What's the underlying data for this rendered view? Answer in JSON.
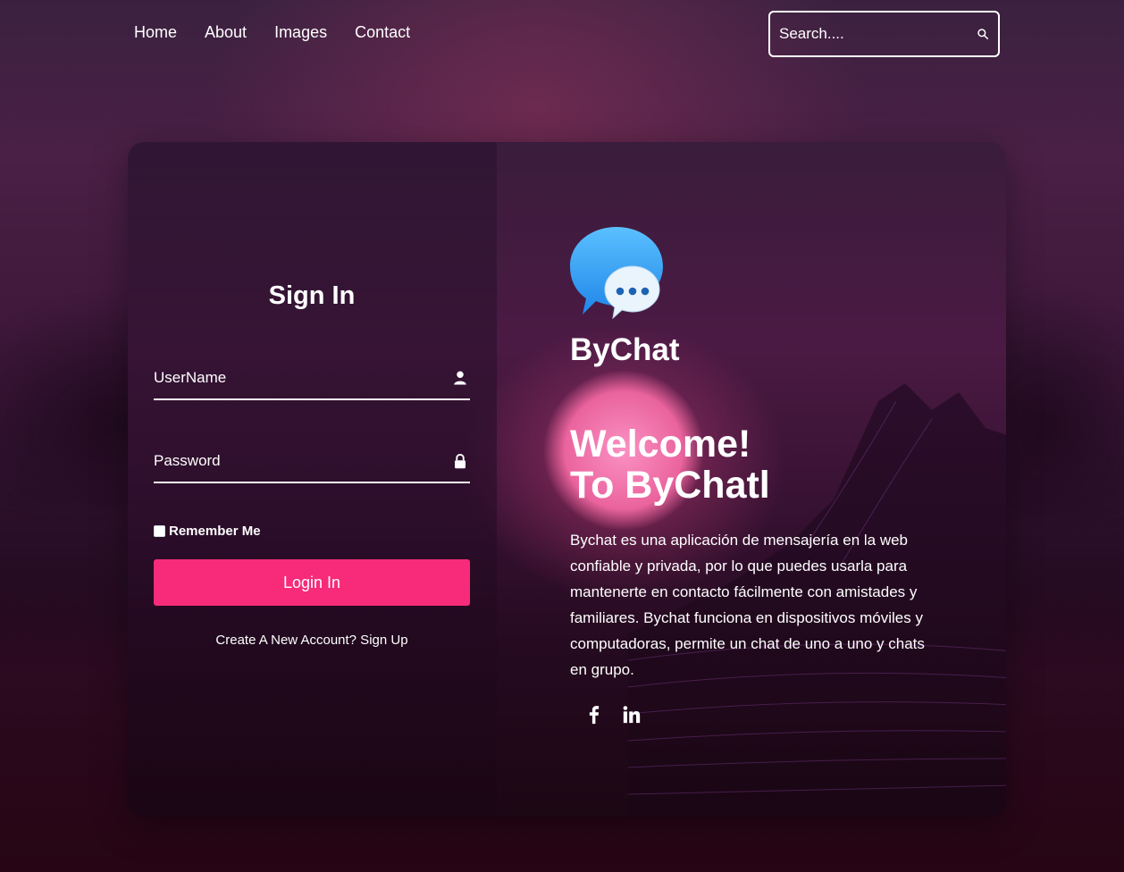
{
  "nav": {
    "links": [
      {
        "label": "Home"
      },
      {
        "label": "About"
      },
      {
        "label": "Images"
      },
      {
        "label": "Contact"
      }
    ],
    "search": {
      "placeholder": "Search...."
    }
  },
  "signin": {
    "title": "Sign In",
    "username_placeholder": "UserName",
    "password_placeholder": "Password",
    "remember_label": "Remember Me",
    "login_label": "Login In",
    "signup_text": "Create A New Account? Sign Up"
  },
  "brand": {
    "name": "ByChat",
    "welcome_line1": "Welcome!",
    "welcome_line2": "To ByChatl",
    "description": "Bychat es una aplicación de mensajería en la web confiable y privada, por lo que puedes usarla para mantenerte en contacto fácilmente con amistades y familiares. Bychat funciona en dispositivos móviles y computadoras, permite un chat de uno a uno y chats en grupo."
  },
  "socials": [
    {
      "icon": "facebook-icon"
    },
    {
      "icon": "linkedin-icon"
    }
  ],
  "colors": {
    "accent": "#f72b79",
    "logo_blue": "#3ea2f5",
    "logo_dots": "#1d63b3"
  }
}
